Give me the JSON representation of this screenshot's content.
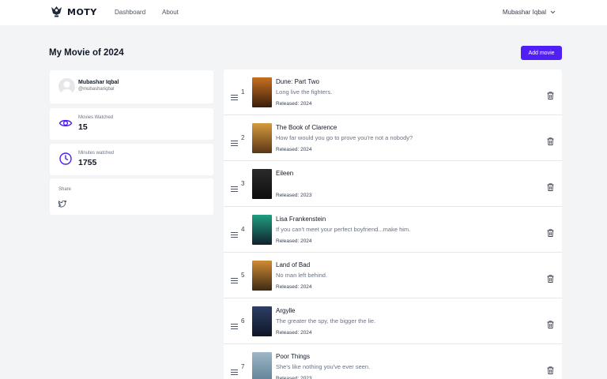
{
  "brand": {
    "name": "MOTY"
  },
  "nav": {
    "dashboard": "Dashboard",
    "about": "About"
  },
  "user_menu": {
    "name": "Mubashar Iqbal"
  },
  "page": {
    "title": "My Movie of 2024",
    "add_button": "Add movie"
  },
  "profile": {
    "name": "Mubashar Iqbal",
    "handle": "@mubashariqbal"
  },
  "stats": {
    "movies_label": "Movies Watched",
    "movies_value": "15",
    "minutes_label": "Minutes watched",
    "minutes_value": "1755"
  },
  "share": {
    "label": "Share"
  },
  "movies": [
    {
      "rank": "1",
      "title": "Dune: Part Two",
      "tagline": "Long live the fighters.",
      "released": "Released: 2024",
      "poster_colors": [
        "#c7701f",
        "#3a1d0c"
      ]
    },
    {
      "rank": "2",
      "title": "The Book of Clarence",
      "tagline": "How far would you go to prove you're not a nobody?",
      "released": "Released: 2024",
      "poster_colors": [
        "#d49a3e",
        "#5b3516"
      ]
    },
    {
      "rank": "3",
      "title": "Eileen",
      "tagline": "",
      "released": "Released: 2023",
      "poster_colors": [
        "#2b2b2b",
        "#0d0d0d"
      ]
    },
    {
      "rank": "4",
      "title": "Lisa Frankenstein",
      "tagline": "If you can't meet your perfect boyfriend...make him.",
      "released": "Released: 2024",
      "poster_colors": [
        "#1f9e80",
        "#12212d"
      ]
    },
    {
      "rank": "5",
      "title": "Land of Bad",
      "tagline": "No man left behind.",
      "released": "Released: 2024",
      "poster_colors": [
        "#d08b34",
        "#3d2a14"
      ]
    },
    {
      "rank": "6",
      "title": "Argylle",
      "tagline": "The greater the spy, the bigger the lie.",
      "released": "Released: 2024",
      "poster_colors": [
        "#2d3f66",
        "#0f1626"
      ]
    },
    {
      "rank": "7",
      "title": "Poor Things",
      "tagline": "She's like nothing you've ever seen.",
      "released": "Released: 2023",
      "poster_colors": [
        "#9fb7c8",
        "#5e7f95"
      ]
    }
  ]
}
